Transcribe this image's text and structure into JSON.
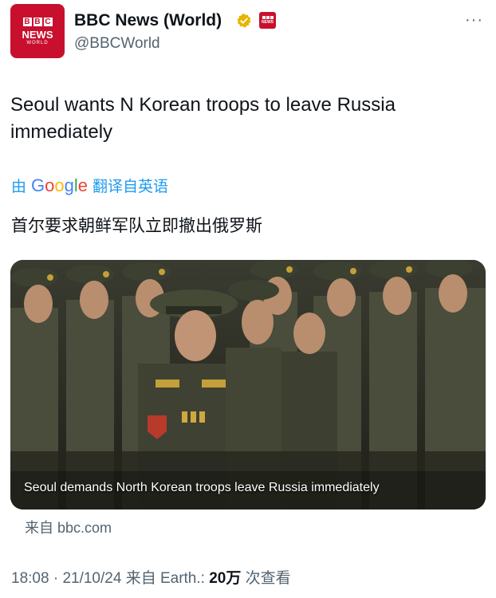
{
  "account": {
    "logo_blocks": [
      "B",
      "B",
      "C"
    ],
    "logo_line1": "NEWS",
    "logo_line2": "WORLD",
    "name": "BBC News (World)",
    "handle": "@BBCWorld",
    "verified_icon": "gold-check-icon",
    "affiliate_badge": "bbc-news-badge"
  },
  "menu": {
    "more_label": "···"
  },
  "tweet": {
    "text": "Seoul wants N Korean troops to leave Russia immediately"
  },
  "translation": {
    "prefix": "由",
    "provider": "Google",
    "suffix": "翻译自英语",
    "text": "首尔要求朝鲜军队立即撤出俄罗斯"
  },
  "media": {
    "caption": "Seoul demands North Korean troops leave Russia immediately",
    "source": "来自 bbc.com"
  },
  "meta": {
    "time": "18:08",
    "separator": "·",
    "date": "21/10/24",
    "via": "来自 Earth.:",
    "views_count": "20万",
    "views_label": "次查看"
  },
  "colors": {
    "brand_red": "#c8102e",
    "link_blue": "#1d9bf0",
    "secondary_text": "#536471",
    "verified_gold": "#e8b400"
  }
}
